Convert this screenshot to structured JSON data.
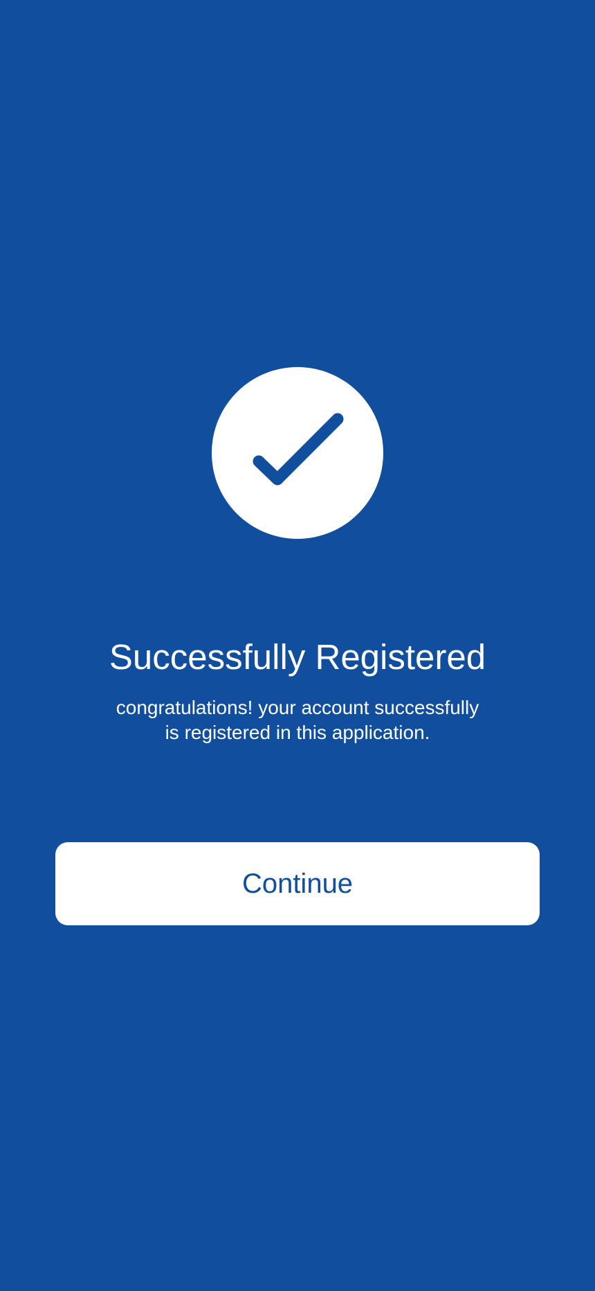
{
  "success": {
    "icon": "check-icon",
    "title": "Successfully Registered",
    "message_line1": "congratulations! your account successfully",
    "message_line2": "is registered in this application."
  },
  "actions": {
    "continue_label": "Continue"
  },
  "colors": {
    "background": "#124E9E",
    "surface": "#FFFFFF",
    "accent": "#124E9E"
  }
}
